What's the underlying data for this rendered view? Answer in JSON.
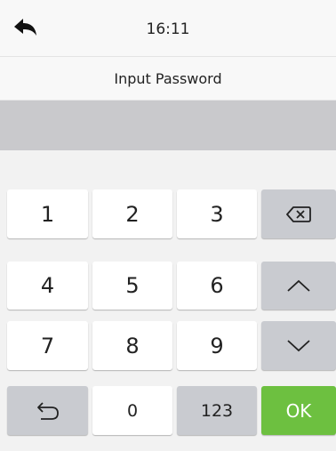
{
  "status": {
    "time": "16:11",
    "back_icon": "back-arrow-icon"
  },
  "title": "Input Password",
  "password": {
    "value": ""
  },
  "keypad": {
    "keys": [
      "1",
      "2",
      "3",
      "4",
      "5",
      "6",
      "7",
      "8",
      "9",
      "0",
      "123",
      "OK"
    ],
    "backspace_icon": "backspace-icon",
    "up_icon": "chevron-up-icon",
    "down_icon": "chevron-down-icon",
    "undo_icon": "undo-icon"
  },
  "colors": {
    "ok": "#6dc040",
    "function_key": "#c9cbd0",
    "password_field": "#c9c9cc"
  }
}
